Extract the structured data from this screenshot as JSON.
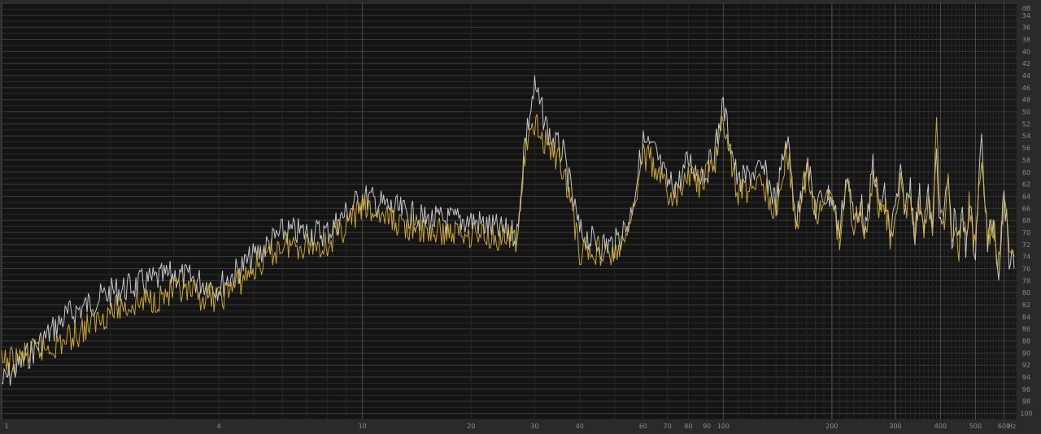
{
  "chart_data": {
    "type": "line",
    "x_scale": "log",
    "x_unit": "Hz",
    "y_unit": "dB",
    "x_ticks": [
      1,
      4,
      10,
      20,
      30,
      40,
      60,
      70,
      80,
      90,
      100,
      200,
      300,
      400,
      500,
      600
    ],
    "y_ticks": [
      34,
      36,
      38,
      40,
      42,
      44,
      46,
      48,
      50,
      52,
      54,
      56,
      58,
      60,
      62,
      64,
      66,
      68,
      70,
      72,
      74,
      76,
      78,
      80,
      82,
      84,
      86,
      88,
      90,
      92,
      94,
      96,
      98,
      100
    ],
    "y_range": [
      32,
      101
    ],
    "x_range": [
      1,
      650
    ],
    "grid": true,
    "series": [
      {
        "color": "#d8d8d8",
        "points": [
          [
            1,
            95
          ],
          [
            1.5,
            84
          ],
          [
            2,
            80
          ],
          [
            3,
            77
          ],
          [
            4,
            79
          ],
          [
            6,
            70
          ],
          [
            8,
            70
          ],
          [
            10,
            64
          ],
          [
            12,
            66
          ],
          [
            15,
            68
          ],
          [
            20,
            68
          ],
          [
            25,
            70
          ],
          [
            27,
            70
          ],
          [
            28,
            56
          ],
          [
            30,
            46
          ],
          [
            33,
            54
          ],
          [
            36,
            57
          ],
          [
            40,
            70
          ],
          [
            45,
            72
          ],
          [
            50,
            72
          ],
          [
            55,
            68
          ],
          [
            60,
            55
          ],
          [
            65,
            57
          ],
          [
            70,
            62
          ],
          [
            75,
            62
          ],
          [
            80,
            58
          ],
          [
            85,
            60
          ],
          [
            90,
            60
          ],
          [
            95,
            56
          ],
          [
            100,
            49
          ],
          [
            110,
            62
          ],
          [
            120,
            60
          ],
          [
            130,
            60
          ],
          [
            140,
            65
          ],
          [
            150,
            54
          ],
          [
            160,
            68
          ],
          [
            170,
            58
          ],
          [
            180,
            66
          ],
          [
            190,
            64
          ],
          [
            200,
            64
          ],
          [
            210,
            70
          ],
          [
            220,
            60
          ],
          [
            230,
            68
          ],
          [
            240,
            65
          ],
          [
            250,
            70
          ],
          [
            260,
            58
          ],
          [
            270,
            66
          ],
          [
            280,
            64
          ],
          [
            290,
            70
          ],
          [
            300,
            66
          ],
          [
            310,
            61
          ],
          [
            320,
            66
          ],
          [
            330,
            62
          ],
          [
            340,
            70
          ],
          [
            350,
            64
          ],
          [
            360,
            68
          ],
          [
            370,
            64
          ],
          [
            380,
            70
          ],
          [
            390,
            56
          ],
          [
            400,
            70
          ],
          [
            410,
            67
          ],
          [
            420,
            60
          ],
          [
            430,
            72
          ],
          [
            440,
            66
          ],
          [
            450,
            72
          ],
          [
            460,
            67
          ],
          [
            470,
            73
          ],
          [
            480,
            64
          ],
          [
            490,
            70
          ],
          [
            500,
            73
          ],
          [
            510,
            62
          ],
          [
            520,
            55
          ],
          [
            540,
            72
          ],
          [
            560,
            68
          ],
          [
            580,
            76
          ],
          [
            600,
            63
          ],
          [
            620,
            74
          ],
          [
            640,
            76
          ]
        ]
      },
      {
        "color": "#d9b23a",
        "points": [
          [
            1,
            92
          ],
          [
            1.5,
            88
          ],
          [
            2,
            83
          ],
          [
            3,
            80
          ],
          [
            4,
            81
          ],
          [
            6,
            72
          ],
          [
            8,
            72
          ],
          [
            10,
            66
          ],
          [
            12,
            68
          ],
          [
            15,
            70
          ],
          [
            20,
            70
          ],
          [
            25,
            71
          ],
          [
            27,
            71
          ],
          [
            28,
            58
          ],
          [
            30,
            52
          ],
          [
            33,
            56
          ],
          [
            36,
            59
          ],
          [
            40,
            73
          ],
          [
            45,
            73
          ],
          [
            50,
            74
          ],
          [
            55,
            70
          ],
          [
            60,
            57
          ],
          [
            65,
            59
          ],
          [
            70,
            64
          ],
          [
            75,
            64
          ],
          [
            80,
            60
          ],
          [
            85,
            62
          ],
          [
            90,
            61
          ],
          [
            95,
            58
          ],
          [
            100,
            51
          ],
          [
            110,
            64
          ],
          [
            120,
            62
          ],
          [
            130,
            62
          ],
          [
            140,
            67
          ],
          [
            150,
            56
          ],
          [
            160,
            69
          ],
          [
            170,
            60
          ],
          [
            180,
            67
          ],
          [
            190,
            65
          ],
          [
            200,
            65
          ],
          [
            210,
            71
          ],
          [
            220,
            61
          ],
          [
            230,
            69
          ],
          [
            240,
            66
          ],
          [
            250,
            71
          ],
          [
            260,
            59
          ],
          [
            270,
            67
          ],
          [
            280,
            65
          ],
          [
            290,
            71
          ],
          [
            300,
            67
          ],
          [
            310,
            62
          ],
          [
            320,
            67
          ],
          [
            330,
            63
          ],
          [
            340,
            71
          ],
          [
            350,
            65
          ],
          [
            360,
            69
          ],
          [
            370,
            65
          ],
          [
            380,
            71
          ],
          [
            390,
            52
          ],
          [
            400,
            68
          ],
          [
            410,
            68
          ],
          [
            420,
            61
          ],
          [
            430,
            73
          ],
          [
            440,
            67
          ],
          [
            450,
            73
          ],
          [
            460,
            68
          ],
          [
            470,
            72
          ],
          [
            480,
            65
          ],
          [
            490,
            71
          ],
          [
            500,
            72
          ],
          [
            510,
            63
          ],
          [
            520,
            58
          ],
          [
            540,
            71
          ],
          [
            560,
            69
          ],
          [
            580,
            75
          ],
          [
            600,
            64
          ],
          [
            620,
            73
          ],
          [
            640,
            74
          ]
        ]
      }
    ]
  }
}
